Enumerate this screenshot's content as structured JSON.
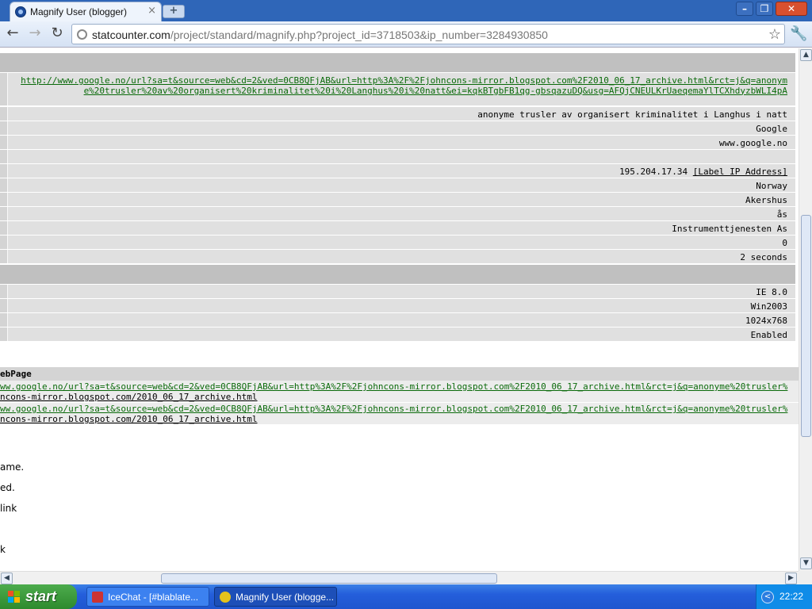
{
  "browser": {
    "tab_title": "Magnify User (blogger)",
    "tab_close": "×",
    "new_tab": "+",
    "url_host": "statcounter.com",
    "url_path": "/project/standard/magnify.php?project_id=3718503&ip_number=3284930850",
    "nav_back": "←",
    "nav_forward": "→",
    "nav_reload": "↻",
    "star": "☆",
    "wrench": "🔧",
    "win_minimize": "–",
    "win_restore": "❐",
    "win_close": "✕"
  },
  "details": {
    "referring_link": "http://www.google.no/url?sa=t&source=web&cd=2&ved=0CB8QFjAB&url=http%3A%2F%2Fjohncons-mirror.blogspot.com%2F2010_06_17_archive.html&rct=j&q=anonyme%20trusler%20av%20organisert%20kriminalitet%20i%20Langhus%20i%20natt&ei=kqkBTgbFB1qg-gbsqazuDQ&usg=AFQjCNEULKrUaeqemaYlTCXhdyzbWLI4pA",
    "search_words": "anonyme trusler av organisert kriminalitet i Langhus i natt",
    "search_engine": "Google",
    "search_host": "www.google.no",
    "ip_address": "195.204.17.34",
    "label_ip": "[Label IP Address]",
    "country": "Norway",
    "region": "Akershus",
    "city": "ås",
    "isp": "Instrumenttjenesten As",
    "returning_visits": "0",
    "visit_length": "2 seconds"
  },
  "system": {
    "browser": "IE 8.0",
    "os": "Win2003",
    "resolution": "1024x768",
    "javascript": "Enabled"
  },
  "webpage": {
    "header": "ebPage",
    "rows": [
      {
        "link": "ww.google.no/url?sa=t&source=web&cd=2&ved=0CB8QFjAB&url=http%3A%2F%2Fjohncons-mirror.blogspot.com%2F2010_06_17_archive.html&rct=j&q=anonyme%20trusler%",
        "page": "ncons-mirror.blogspot.com/2010_06_17_archive.html"
      },
      {
        "link": "ww.google.no/url?sa=t&source=web&cd=2&ved=0CB8QFjAB&url=http%3A%2F%2Fjohncons-mirror.blogspot.com%2F2010_06_17_archive.html&rct=j&q=anonyme%20trusler%",
        "page": "ncons-mirror.blogspot.com/2010_06_17_archive.html"
      }
    ]
  },
  "notes": [
    "ame.",
    "ed.",
    " link",
    "k"
  ],
  "taskbar": {
    "start": "start",
    "tasks": [
      "IceChat - [#blablate...",
      "Magnify User (blogge..."
    ],
    "tray_arrow": "<",
    "clock": "22:22"
  }
}
